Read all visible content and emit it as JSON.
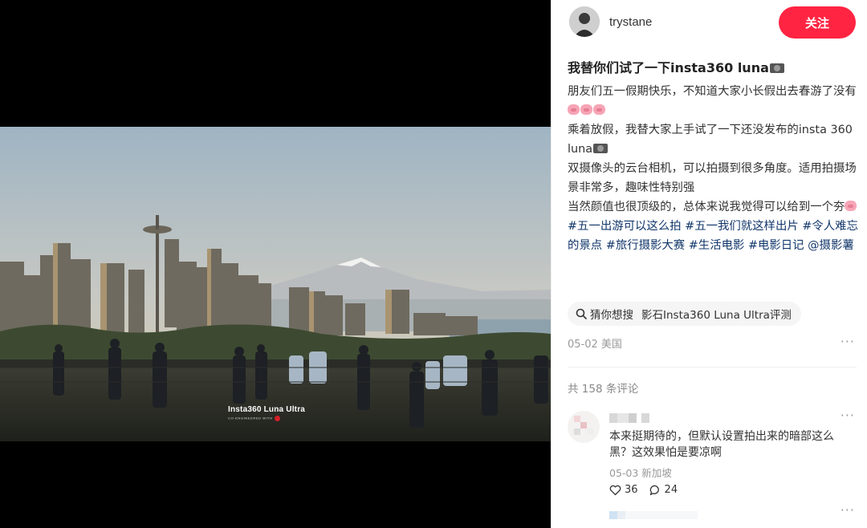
{
  "post": {
    "author": "trystane",
    "follow_label": "关注",
    "title": "我替你们试了一下insta360 luna",
    "body": {
      "line1": "朋友们五一假期快乐，不知道大家小长假出去春游了没有",
      "line2": "乘着放假，我替大家上手试了一下还没发布的insta 360 luna",
      "line3": "双摄像头的云台相机，可以拍摄到很多角度。适用拍摄场景非常多，趣味性特别强",
      "line4": "当然颜值也很顶级的，总体来说我觉得可以给到一个夯"
    },
    "tags": [
      "#五一出游可以这么拍",
      "#五一我们就这样出片",
      "#令人难忘的景点",
      "#旅行摄影大赛",
      "#生活电影",
      "#电影日记",
      "@摄影薯"
    ],
    "search": {
      "label": "猜你想搜",
      "query": "影石Insta360 Luna Ultra评测"
    },
    "date": "05-02 美国",
    "more": "···"
  },
  "media": {
    "watermark_main": "Insta360  Luna Ultra",
    "watermark_sub": "CO-ENGINEERED WITH"
  },
  "comments": {
    "count_label": "共 158 条评论",
    "items": [
      {
        "text": "本来挺期待的，但默认设置拍出来的暗部这么黑？这效果怕是要凉啊",
        "meta": "05-03 新加坡",
        "likes": "36",
        "replies": "24"
      }
    ]
  },
  "icons": [
    "search-icon",
    "heart-icon",
    "comment-icon",
    "more-icon",
    "pig-emoji",
    "camera-emoji"
  ],
  "colors": {
    "accent": "#ff2442",
    "tag": "#13386c",
    "meta": "#999999"
  }
}
